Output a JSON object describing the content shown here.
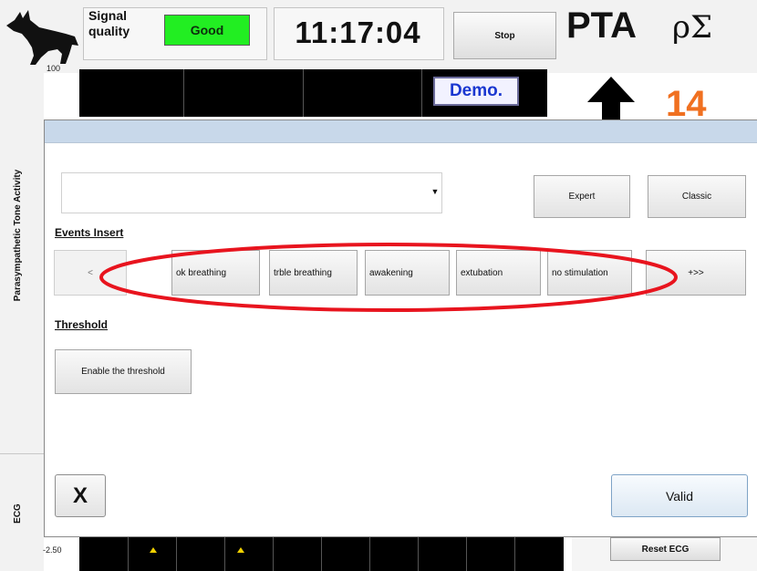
{
  "header": {
    "signal_label": "Signal quality",
    "signal_value": "Good",
    "clock": "11:17:04",
    "stop_label": "Stop",
    "title": "PTA",
    "symbol": "ρΣ",
    "logo_icon": "dog-silhouette-icon"
  },
  "monitor": {
    "y_max": "100",
    "y_min": "-2.50",
    "demo_label": "Demo.",
    "trend_icon": "up-arrow-icon",
    "trend_value": "14",
    "trend_value_color": "#f07020",
    "side_label_top": "Parasympathetic Tone Activity",
    "side_label_bottom": "ECG",
    "reset_ecg_label": "Reset ECG"
  },
  "dialog": {
    "combo_value": "",
    "combo_arrow_icon": "dropdown-arrow-icon",
    "expert_label": "Expert",
    "classic_label": "Classic",
    "events_heading": "Events Insert",
    "events_prev_label": "<",
    "events": [
      "ok breathing",
      "trble breathing",
      "awakening",
      "extubation",
      "no stimulation"
    ],
    "events_next_label": "+>>",
    "threshold_heading": "Threshold",
    "threshold_button_label": "Enable the threshold",
    "close_label": "X",
    "valid_label": "Valid",
    "highlight_color": "#e8141e"
  }
}
